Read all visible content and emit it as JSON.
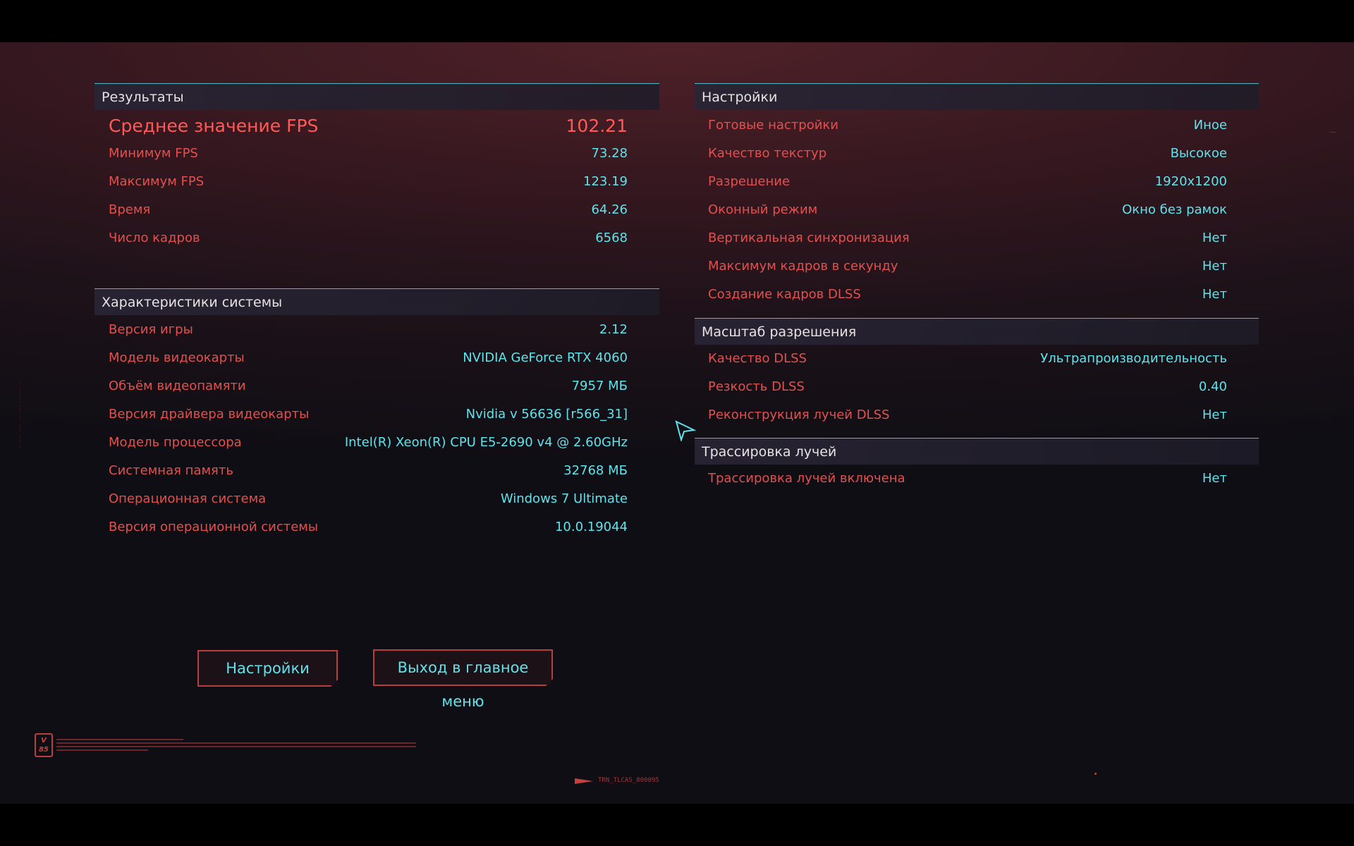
{
  "results": {
    "title": "Результаты",
    "avg_fps": {
      "label": "Среднее значение FPS",
      "value": "102.21"
    },
    "rows": [
      {
        "label": "Минимум FPS",
        "value": "73.28"
      },
      {
        "label": "Максимум FPS",
        "value": "123.19"
      },
      {
        "label": "Время",
        "value": "64.26"
      },
      {
        "label": "Число кадров",
        "value": "6568"
      }
    ]
  },
  "system": {
    "title": "Характеристики системы",
    "rows": [
      {
        "label": "Версия игры",
        "value": "2.12"
      },
      {
        "label": "Модель видеокарты",
        "value": "NVIDIA GeForce RTX 4060"
      },
      {
        "label": "Объём видеопамяти",
        "value": "7957 МБ"
      },
      {
        "label": "Версия драйвера видеокарты",
        "value": "Nvidia v 56636 [r566_31]"
      },
      {
        "label": "Модель процессора",
        "value": "Intel(R) Xeon(R) CPU E5-2690 v4 @ 2.60GHz"
      },
      {
        "label": "Системная память",
        "value": "32768 МБ"
      },
      {
        "label": "Операционная система",
        "value": "Windows 7 Ultimate"
      },
      {
        "label": "Версия операционной системы",
        "value": "10.0.19044"
      }
    ]
  },
  "settings": {
    "title": "Настройки",
    "rows": [
      {
        "label": "Готовые настройки",
        "value": "Иное"
      },
      {
        "label": "Качество текстур",
        "value": "Высокое"
      },
      {
        "label": "Разрешение",
        "value": "1920x1200"
      },
      {
        "label": "Оконный режим",
        "value": "Окно без рамок"
      },
      {
        "label": "Вертикальная синхронизация",
        "value": "Нет"
      },
      {
        "label": "Максимум кадров в секунду",
        "value": "Нет"
      },
      {
        "label": "Создание кадров DLSS",
        "value": "Нет"
      }
    ]
  },
  "scaling": {
    "title": "Масштаб разрешения",
    "rows": [
      {
        "label": "Качество DLSS",
        "value": "Ультрапроизводительность"
      },
      {
        "label": "Резкость DLSS",
        "value": "0.40"
      },
      {
        "label": "Реконструкция лучей DLSS",
        "value": "Нет"
      }
    ]
  },
  "raytracing": {
    "title": "Трассировка лучей",
    "rows": [
      {
        "label": "Трассировка лучей включена",
        "value": "Нет"
      }
    ]
  },
  "buttons": {
    "settings": "Настройки",
    "main_menu": "Выход в главное меню"
  },
  "footer": {
    "logo": "V\n85",
    "build_tag": "TRN_TLCAS_800095"
  },
  "colors": {
    "label": "#e2504f",
    "value": "#5fe4ec",
    "accent_line": "#4fb8c4",
    "button_border": "#b7403f"
  }
}
